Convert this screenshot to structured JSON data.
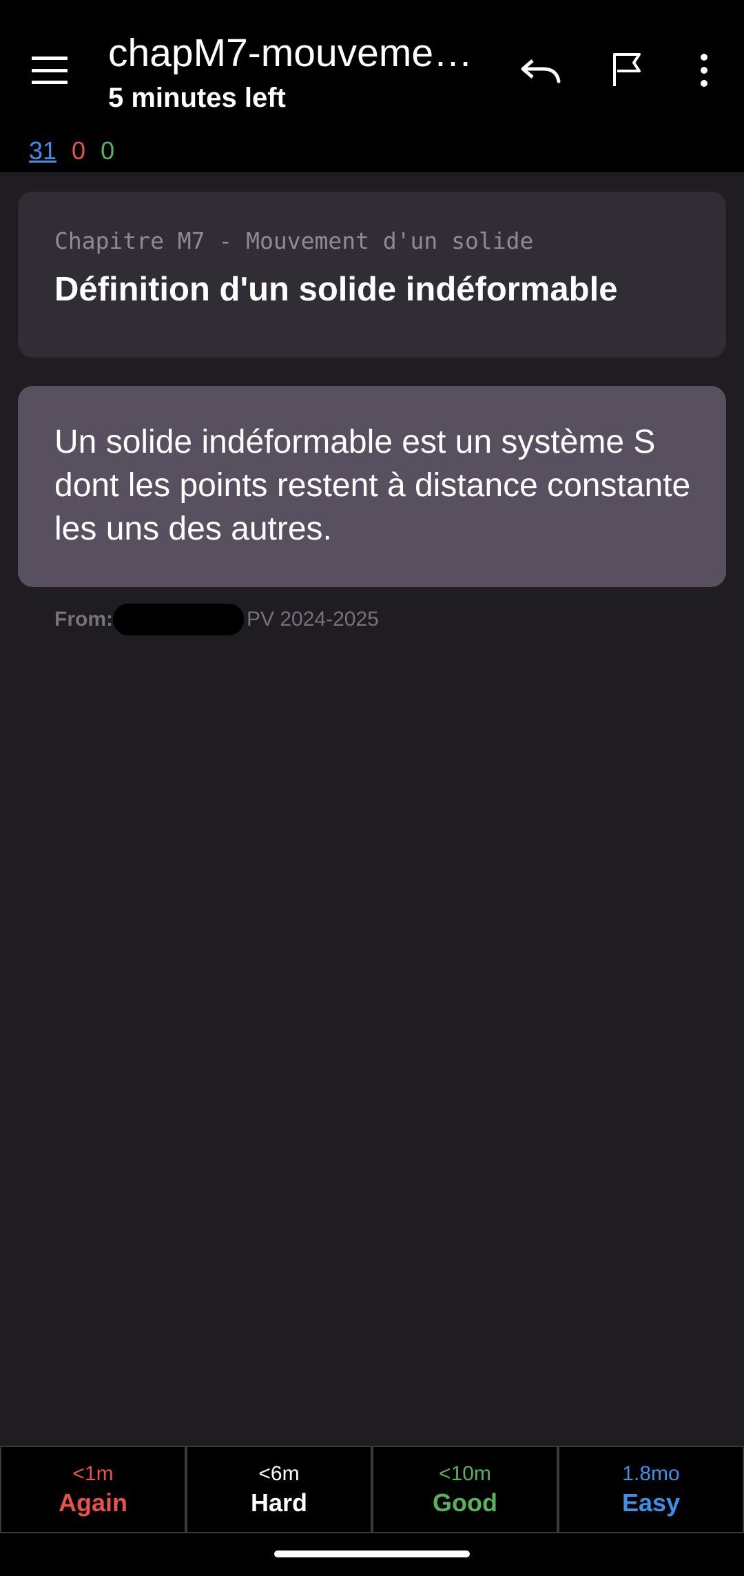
{
  "toolbar": {
    "title": "chapM7-mouveme…",
    "subtitle": "5 minutes left",
    "icons": {
      "menu": "hamburger-menu-icon",
      "undo": "undo-icon",
      "flag": "flag-icon",
      "more": "more-vertical-icon"
    }
  },
  "counts": {
    "new": "31",
    "learning": "0",
    "review": "0"
  },
  "card": {
    "chapter": "Chapitre M7 - Mouvement d'un solide",
    "title": "Définition d'un solide indéformable",
    "answer": "Un solide indéformable est un système S dont les points restent à distance constante les uns des autres."
  },
  "source": {
    "prefix": "From:",
    "deck": "PV 2024-2025"
  },
  "answers": [
    {
      "interval": "<1m",
      "label": "Again"
    },
    {
      "interval": "<6m",
      "label": "Hard"
    },
    {
      "interval": "<10m",
      "label": "Good"
    },
    {
      "interval": "1.8mo",
      "label": "Easy"
    }
  ],
  "colors": {
    "again": "#e5534b",
    "good": "#57b35a",
    "easy": "#3f8fe8",
    "background": "#201d22"
  }
}
